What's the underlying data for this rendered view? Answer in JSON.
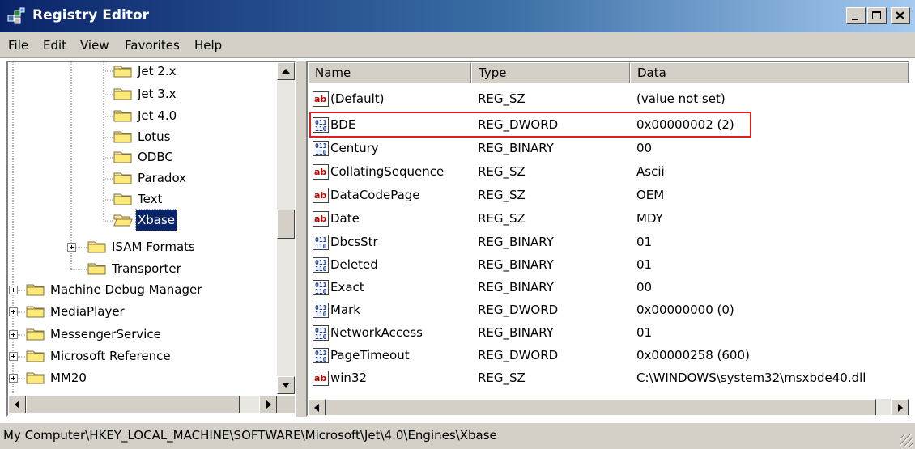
{
  "window": {
    "title": "Registry Editor",
    "app_icon": "registry-editor-icon",
    "controls": [
      "minimize",
      "maximize",
      "close"
    ]
  },
  "menu": [
    "File",
    "Edit",
    "View",
    "Favorites",
    "Help"
  ],
  "tree": {
    "nodes": [
      {
        "label": "Jet 2.x",
        "icon": "folder-icon",
        "selected": false,
        "expander": false
      },
      {
        "label": "Jet 3.x",
        "icon": "folder-icon",
        "selected": false,
        "expander": false
      },
      {
        "label": "Jet 4.0",
        "icon": "folder-icon",
        "selected": false,
        "expander": false
      },
      {
        "label": "Lotus",
        "icon": "folder-icon",
        "selected": false,
        "expander": false
      },
      {
        "label": "ODBC",
        "icon": "folder-icon",
        "selected": false,
        "expander": false
      },
      {
        "label": "Paradox",
        "icon": "folder-icon",
        "selected": false,
        "expander": false
      },
      {
        "label": "Text",
        "icon": "folder-icon",
        "selected": false,
        "expander": false
      },
      {
        "label": "Xbase",
        "icon": "open-folder-icon",
        "selected": true,
        "expander": false
      },
      {
        "label": "ISAM Formats",
        "icon": "folder-icon",
        "selected": false,
        "expander": true
      },
      {
        "label": "Transporter",
        "icon": "folder-icon",
        "selected": false,
        "expander": false
      },
      {
        "label": "Machine Debug Manager",
        "icon": "folder-icon",
        "selected": false,
        "expander": true
      },
      {
        "label": "MediaPlayer",
        "icon": "folder-icon",
        "selected": false,
        "expander": true
      },
      {
        "label": "MessengerService",
        "icon": "folder-icon",
        "selected": false,
        "expander": true
      },
      {
        "label": "Microsoft Reference",
        "icon": "folder-icon",
        "selected": false,
        "expander": true
      },
      {
        "label": "MM20",
        "icon": "folder-icon",
        "selected": false,
        "expander": true
      }
    ]
  },
  "list": {
    "columns": [
      "Name",
      "Type",
      "Data"
    ],
    "rows": [
      {
        "name": "(Default)",
        "type": "REG_SZ",
        "data": "(value not set)",
        "icon": "string-value-icon"
      },
      {
        "name": "BDE",
        "type": "REG_DWORD",
        "data": "0x00000002 (2)",
        "icon": "binary-value-icon"
      },
      {
        "name": "Century",
        "type": "REG_BINARY",
        "data": "00",
        "icon": "binary-value-icon"
      },
      {
        "name": "CollatingSequence",
        "type": "REG_SZ",
        "data": "Ascii",
        "icon": "string-value-icon"
      },
      {
        "name": "DataCodePage",
        "type": "REG_SZ",
        "data": "OEM",
        "icon": "string-value-icon"
      },
      {
        "name": "Date",
        "type": "REG_SZ",
        "data": "MDY",
        "icon": "string-value-icon"
      },
      {
        "name": "DbcsStr",
        "type": "REG_BINARY",
        "data": "01",
        "icon": "binary-value-icon"
      },
      {
        "name": "Deleted",
        "type": "REG_BINARY",
        "data": "01",
        "icon": "binary-value-icon"
      },
      {
        "name": "Exact",
        "type": "REG_BINARY",
        "data": "00",
        "icon": "binary-value-icon"
      },
      {
        "name": "Mark",
        "type": "REG_DWORD",
        "data": "0x00000000 (0)",
        "icon": "binary-value-icon"
      },
      {
        "name": "NetworkAccess",
        "type": "REG_BINARY",
        "data": "01",
        "icon": "binary-value-icon"
      },
      {
        "name": "PageTimeout",
        "type": "REG_DWORD",
        "data": "0x00000258 (600)",
        "icon": "binary-value-icon"
      },
      {
        "name": "win32",
        "type": "REG_SZ",
        "data": "C:\\WINDOWS\\system32\\msxbde40.dll",
        "icon": "string-value-icon"
      }
    ],
    "highlighted_row": "BDE",
    "highlight_color": "#e02020"
  },
  "status": "My Computer\\HKEY_LOCAL_MACHINE\\SOFTWARE\\Microsoft\\Jet\\4.0\\Engines\\Xbase",
  "colors": {
    "title_gradient_start": "#0a246a",
    "title_gradient_end": "#a6caf0",
    "chrome": "#d4d0c8",
    "selection": "#0a246a"
  }
}
